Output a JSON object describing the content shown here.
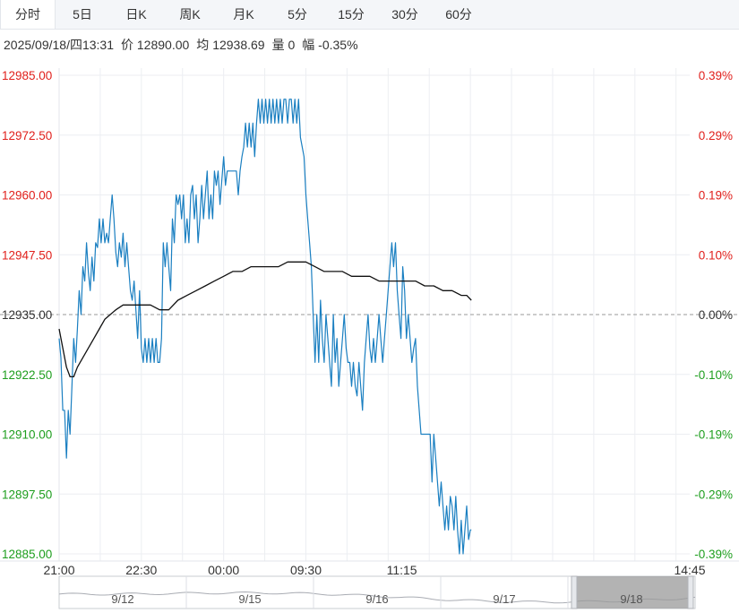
{
  "tabs": [
    {
      "label": "分时",
      "active": true
    },
    {
      "label": "5日",
      "active": false
    },
    {
      "label": "日K",
      "active": false
    },
    {
      "label": "周K",
      "active": false
    },
    {
      "label": "月K",
      "active": false
    },
    {
      "label": "5分",
      "active": false
    },
    {
      "label": "15分",
      "active": false
    },
    {
      "label": "30分",
      "active": false
    },
    {
      "label": "60分",
      "active": false
    }
  ],
  "info": {
    "datetime": "2025/09/18/四13:31",
    "price_label": "价",
    "price": "12890.00",
    "avg_label": "均",
    "avg": "12938.69",
    "volume_label": "量",
    "volume": "0",
    "change_label": "幅",
    "change": "-0.35%"
  },
  "colors": {
    "up": "#e0201c",
    "down": "#1e9e1e",
    "neutral": "#333333",
    "price_line": "#1a7fc1",
    "avg_line": "#111111",
    "grid": "#eceef2"
  },
  "chart_data": {
    "type": "line",
    "ylim": [
      12885.0,
      12985.0
    ],
    "base_price": 12935.0,
    "y_ticks_left": [
      "12985.00",
      "12972.50",
      "12960.00",
      "12947.50",
      "12935.00",
      "12922.50",
      "12910.00",
      "12897.50",
      "12885.00"
    ],
    "y_ticks_right": [
      "0.39%",
      "0.29%",
      "0.19%",
      "0.10%",
      "0.00%",
      "-0.10%",
      "-0.19%",
      "-0.29%",
      "-0.39%"
    ],
    "x_ticks": [
      "21:00",
      "22:30",
      "00:00",
      "09:30",
      "11:15",
      "14:45"
    ],
    "x_range_minutes": [
      0,
      690
    ],
    "series": [
      {
        "role": "price",
        "points": [
          [
            0,
            12930
          ],
          [
            2,
            12926
          ],
          [
            4,
            12915
          ],
          [
            6,
            12915
          ],
          [
            8,
            12905
          ],
          [
            10,
            12915
          ],
          [
            12,
            12910
          ],
          [
            14,
            12920
          ],
          [
            16,
            12930
          ],
          [
            18,
            12925
          ],
          [
            20,
            12932
          ],
          [
            22,
            12940
          ],
          [
            24,
            12935
          ],
          [
            26,
            12945
          ],
          [
            28,
            12942
          ],
          [
            30,
            12950
          ],
          [
            32,
            12944
          ],
          [
            34,
            12940
          ],
          [
            36,
            12947
          ],
          [
            38,
            12942
          ],
          [
            40,
            12950
          ],
          [
            42,
            12949
          ],
          [
            44,
            12955
          ],
          [
            46,
            12950
          ],
          [
            48,
            12955
          ],
          [
            50,
            12950
          ],
          [
            52,
            12952
          ],
          [
            54,
            12950
          ],
          [
            56,
            12955
          ],
          [
            58,
            12960
          ],
          [
            60,
            12955
          ],
          [
            62,
            12948
          ],
          [
            64,
            12945
          ],
          [
            66,
            12950
          ],
          [
            68,
            12947
          ],
          [
            70,
            12952
          ],
          [
            72,
            12945
          ],
          [
            74,
            12950
          ],
          [
            76,
            12945
          ],
          [
            78,
            12940
          ],
          [
            80,
            12938
          ],
          [
            82,
            12942
          ],
          [
            84,
            12936
          ],
          [
            86,
            12930
          ],
          [
            88,
            12940
          ],
          [
            90,
            12928
          ],
          [
            92,
            12925
          ],
          [
            94,
            12930
          ],
          [
            96,
            12925
          ],
          [
            98,
            12930
          ],
          [
            100,
            12925
          ],
          [
            102,
            12930
          ],
          [
            104,
            12925
          ],
          [
            106,
            12930
          ],
          [
            108,
            12925
          ],
          [
            110,
            12925
          ],
          [
            112,
            12930
          ],
          [
            114,
            12950
          ],
          [
            116,
            12945
          ],
          [
            118,
            12950
          ],
          [
            120,
            12945
          ],
          [
            122,
            12940
          ],
          [
            124,
            12955
          ],
          [
            126,
            12950
          ],
          [
            128,
            12960
          ],
          [
            130,
            12958
          ],
          [
            132,
            12960
          ],
          [
            134,
            12955
          ],
          [
            136,
            12960
          ],
          [
            138,
            12950
          ],
          [
            140,
            12955
          ],
          [
            142,
            12950
          ],
          [
            144,
            12960
          ],
          [
            146,
            12962
          ],
          [
            148,
            12955
          ],
          [
            150,
            12960
          ],
          [
            152,
            12950
          ],
          [
            154,
            12955
          ],
          [
            156,
            12962
          ],
          [
            158,
            12955
          ],
          [
            160,
            12960
          ],
          [
            162,
            12965
          ],
          [
            164,
            12955
          ],
          [
            166,
            12960
          ],
          [
            168,
            12955
          ],
          [
            170,
            12965
          ],
          [
            172,
            12962
          ],
          [
            174,
            12965
          ],
          [
            176,
            12958
          ],
          [
            178,
            12963
          ],
          [
            180,
            12968
          ],
          [
            182,
            12962
          ],
          [
            184,
            12965
          ],
          [
            186,
            12965
          ],
          [
            188,
            12965
          ],
          [
            190,
            12965
          ],
          [
            192,
            12965
          ],
          [
            194,
            12965
          ],
          [
            196,
            12960
          ],
          [
            198,
            12965
          ],
          [
            200,
            12968
          ],
          [
            202,
            12970
          ],
          [
            204,
            12975
          ],
          [
            206,
            12970
          ],
          [
            208,
            12975
          ],
          [
            210,
            12970
          ],
          [
            212,
            12975
          ],
          [
            214,
            12968
          ],
          [
            216,
            12975
          ],
          [
            218,
            12980
          ],
          [
            220,
            12975
          ],
          [
            222,
            12980
          ],
          [
            224,
            12975
          ],
          [
            226,
            12980
          ],
          [
            228,
            12975
          ],
          [
            230,
            12980
          ],
          [
            232,
            12975
          ],
          [
            234,
            12980
          ],
          [
            236,
            12975
          ],
          [
            238,
            12980
          ],
          [
            240,
            12975
          ],
          [
            242,
            12980
          ],
          [
            244,
            12975
          ],
          [
            246,
            12980
          ],
          [
            248,
            12980
          ],
          [
            250,
            12975
          ],
          [
            252,
            12980
          ],
          [
            254,
            12980
          ],
          [
            256,
            12975
          ],
          [
            258,
            12980
          ],
          [
            260,
            12975
          ],
          [
            262,
            12980
          ],
          [
            264,
            12972
          ],
          [
            266,
            12970
          ],
          [
            268,
            12968
          ],
          [
            270,
            12960
          ],
          [
            272,
            12955
          ],
          [
            274,
            12950
          ],
          [
            276,
            12945
          ],
          [
            278,
            12935
          ],
          [
            280,
            12925
          ],
          [
            282,
            12935
          ],
          [
            284,
            12925
          ],
          [
            286,
            12938
          ],
          [
            288,
            12930
          ],
          [
            290,
            12925
          ],
          [
            292,
            12935
          ],
          [
            294,
            12930
          ],
          [
            296,
            12925
          ],
          [
            298,
            12920
          ],
          [
            300,
            12935
          ],
          [
            302,
            12925
          ],
          [
            304,
            12930
          ],
          [
            306,
            12920
          ],
          [
            308,
            12925
          ],
          [
            310,
            12930
          ],
          [
            312,
            12935
          ],
          [
            314,
            12928
          ],
          [
            316,
            12925
          ],
          [
            318,
            12925
          ],
          [
            320,
            12920
          ],
          [
            322,
            12925
          ],
          [
            324,
            12920
          ],
          [
            326,
            12918
          ],
          [
            328,
            12925
          ],
          [
            330,
            12920
          ],
          [
            332,
            12915
          ],
          [
            334,
            12925
          ],
          [
            336,
            12930
          ],
          [
            338,
            12935
          ],
          [
            340,
            12928
          ],
          [
            342,
            12925
          ],
          [
            344,
            12930
          ],
          [
            346,
            12925
          ],
          [
            348,
            12930
          ],
          [
            350,
            12935
          ],
          [
            352,
            12930
          ],
          [
            354,
            12925
          ],
          [
            356,
            12930
          ],
          [
            358,
            12935
          ],
          [
            360,
            12940
          ],
          [
            362,
            12945
          ],
          [
            364,
            12950
          ],
          [
            366,
            12945
          ],
          [
            368,
            12950
          ],
          [
            370,
            12940
          ],
          [
            372,
            12935
          ],
          [
            374,
            12930
          ],
          [
            376,
            12945
          ],
          [
            378,
            12940
          ],
          [
            380,
            12930
          ],
          [
            382,
            12935
          ],
          [
            384,
            12930
          ],
          [
            386,
            12925
          ],
          [
            388,
            12928
          ],
          [
            390,
            12930
          ],
          [
            392,
            12920
          ],
          [
            394,
            12915
          ],
          [
            396,
            12910
          ],
          [
            398,
            12910
          ],
          [
            400,
            12910
          ],
          [
            402,
            12910
          ],
          [
            404,
            12910
          ],
          [
            406,
            12910
          ],
          [
            408,
            12900
          ],
          [
            410,
            12910
          ],
          [
            412,
            12905
          ],
          [
            414,
            12900
          ],
          [
            416,
            12895
          ],
          [
            418,
            12900
          ],
          [
            420,
            12895
          ],
          [
            422,
            12890
          ],
          [
            424,
            12895
          ],
          [
            426,
            12890
          ],
          [
            428,
            12897
          ],
          [
            430,
            12895
          ],
          [
            432,
            12890
          ],
          [
            434,
            12897
          ],
          [
            436,
            12890
          ],
          [
            438,
            12885
          ],
          [
            440,
            12892
          ],
          [
            442,
            12885
          ],
          [
            444,
            12890
          ],
          [
            446,
            12895
          ],
          [
            448,
            12888
          ],
          [
            450,
            12890
          ],
          [
            451,
            12890
          ]
        ]
      },
      {
        "role": "average",
        "points": [
          [
            0,
            12932
          ],
          [
            4,
            12928
          ],
          [
            8,
            12924
          ],
          [
            12,
            12922
          ],
          [
            16,
            12922
          ],
          [
            20,
            12924
          ],
          [
            26,
            12926
          ],
          [
            32,
            12928
          ],
          [
            38,
            12930
          ],
          [
            44,
            12932
          ],
          [
            50,
            12934
          ],
          [
            56,
            12935
          ],
          [
            62,
            12936
          ],
          [
            70,
            12937
          ],
          [
            80,
            12937
          ],
          [
            90,
            12937
          ],
          [
            100,
            12937
          ],
          [
            110,
            12936
          ],
          [
            120,
            12936
          ],
          [
            130,
            12938
          ],
          [
            140,
            12939
          ],
          [
            150,
            12940
          ],
          [
            160,
            12941
          ],
          [
            170,
            12942
          ],
          [
            180,
            12943
          ],
          [
            190,
            12944
          ],
          [
            200,
            12944
          ],
          [
            210,
            12945
          ],
          [
            220,
            12945
          ],
          [
            230,
            12945
          ],
          [
            240,
            12945
          ],
          [
            250,
            12946
          ],
          [
            260,
            12946
          ],
          [
            270,
            12946
          ],
          [
            280,
            12945
          ],
          [
            290,
            12944
          ],
          [
            300,
            12944
          ],
          [
            310,
            12944
          ],
          [
            320,
            12943
          ],
          [
            330,
            12943
          ],
          [
            340,
            12943
          ],
          [
            350,
            12942
          ],
          [
            360,
            12942
          ],
          [
            370,
            12942
          ],
          [
            380,
            12942
          ],
          [
            390,
            12942
          ],
          [
            400,
            12941
          ],
          [
            410,
            12941
          ],
          [
            420,
            12940
          ],
          [
            430,
            12940
          ],
          [
            440,
            12939
          ],
          [
            446,
            12939
          ],
          [
            451,
            12938
          ]
        ]
      }
    ]
  },
  "navigator": {
    "dates": [
      "9/12",
      "9/15",
      "9/16",
      "9/17",
      "9/18"
    ],
    "selected": "9/18"
  }
}
